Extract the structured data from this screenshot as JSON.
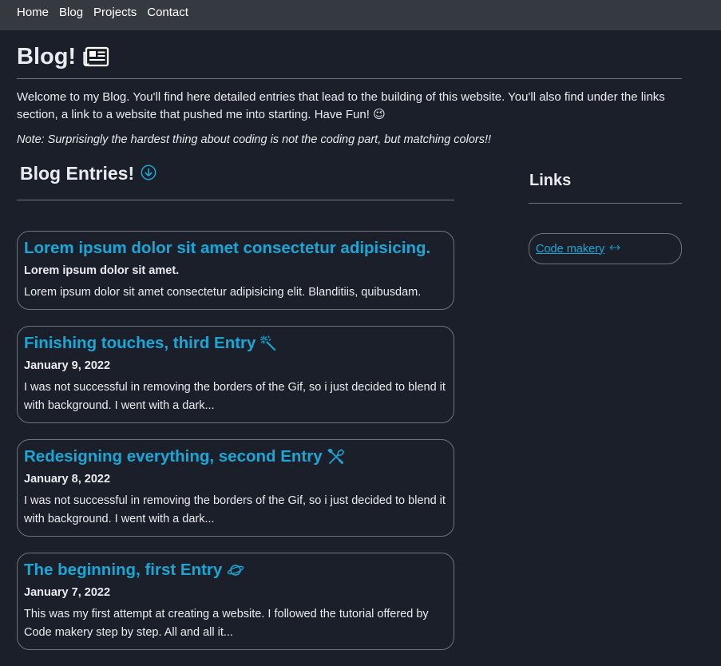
{
  "nav": {
    "items": [
      "Home",
      "Blog",
      "Projects",
      "Contact"
    ]
  },
  "header": {
    "title": "Blog!",
    "icon": "newspaper-icon"
  },
  "intro": {
    "welcome": "Welcome to my Blog. You'll find here detailed entries that lead to the building of this website. You'll also find under the links section, a link to a website that pushed me into starting. Have Fun! 😉",
    "note": "Note: Surprisingly the hardest thing about coding is not the coding part, but matching colors!!"
  },
  "entries_section": {
    "title": "Blog Entries!",
    "icon": "arrow-down-circle-icon"
  },
  "entries": [
    {
      "title": "Lorem ipsum dolor sit amet consectetur adipisicing.",
      "subtitle": "Lorem ipsum dolor sit amet.",
      "text": "Lorem ipsum dolor sit amet consectetur adipisicing elit. Blanditiis, quibusdam.",
      "icon": ""
    },
    {
      "title": "Finishing touches, third Entry",
      "subtitle": "January 9, 2022",
      "text": "I was not successful in removing the borders of the Gif, so i just decided to blend it with background. I went with a dark...",
      "icon": "magic-wand-icon"
    },
    {
      "title": "Redesigning everything, second Entry",
      "subtitle": "January 8, 2022",
      "text": "I was not successful in removing the borders of the Gif, so i just decided to blend it with background. I went with a dark...",
      "icon": "tools-icon"
    },
    {
      "title": "The beginning, first Entry",
      "subtitle": "January 7, 2022",
      "text": "This was my first attempt at creating a website. I followed the tutorial offered by Code makery step by step. All and all it...",
      "icon": "planet-icon"
    }
  ],
  "links_section": {
    "title": "Links"
  },
  "links": [
    {
      "label": "Code makery",
      "icon": "arrows-expand-icon"
    }
  ],
  "colors": {
    "background": "#1b1f2a",
    "navbar": "#343a40",
    "accent": "#1aa7d6",
    "border": "#6c757d"
  }
}
